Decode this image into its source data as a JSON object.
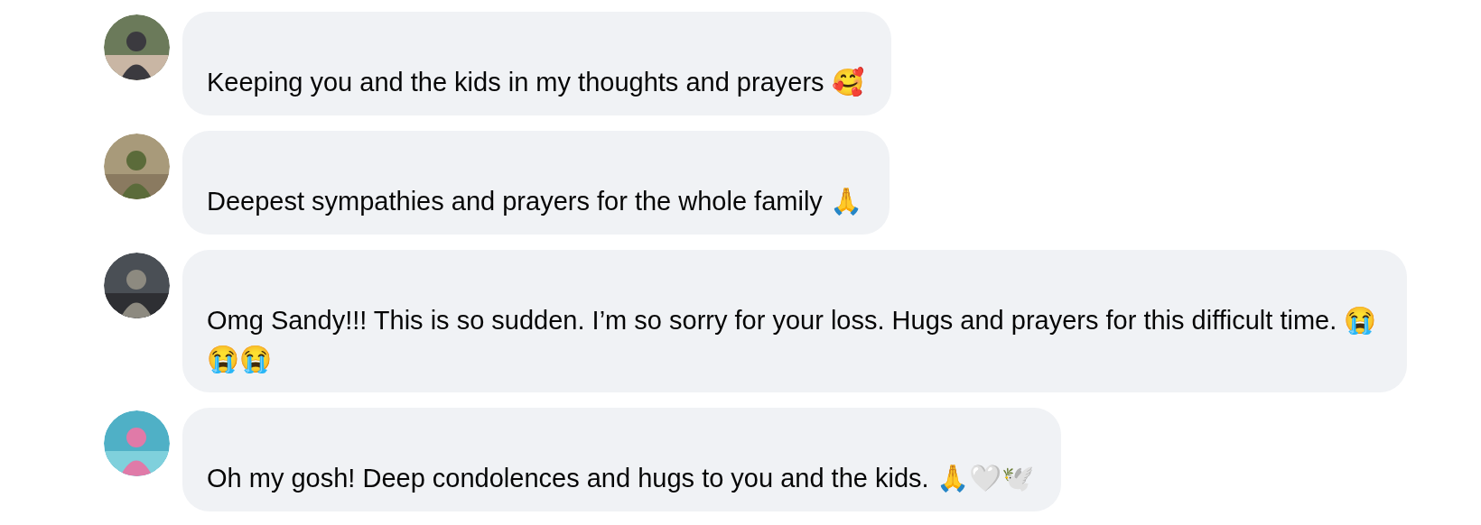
{
  "comments": [
    {
      "text": "Keeping you and the kids in my thoughts and prayers 🥰"
    },
    {
      "text": "Deepest sympathies and prayers for the whole family 🙏"
    },
    {
      "text": "Omg Sandy!!! This is so sudden. I’m so sorry for your loss. Hugs and prayers for this difficult time. 😭😭😭"
    },
    {
      "text": "Oh my gosh! Deep condolences and hugs to you and the kids. 🙏🤍🕊️"
    }
  ]
}
